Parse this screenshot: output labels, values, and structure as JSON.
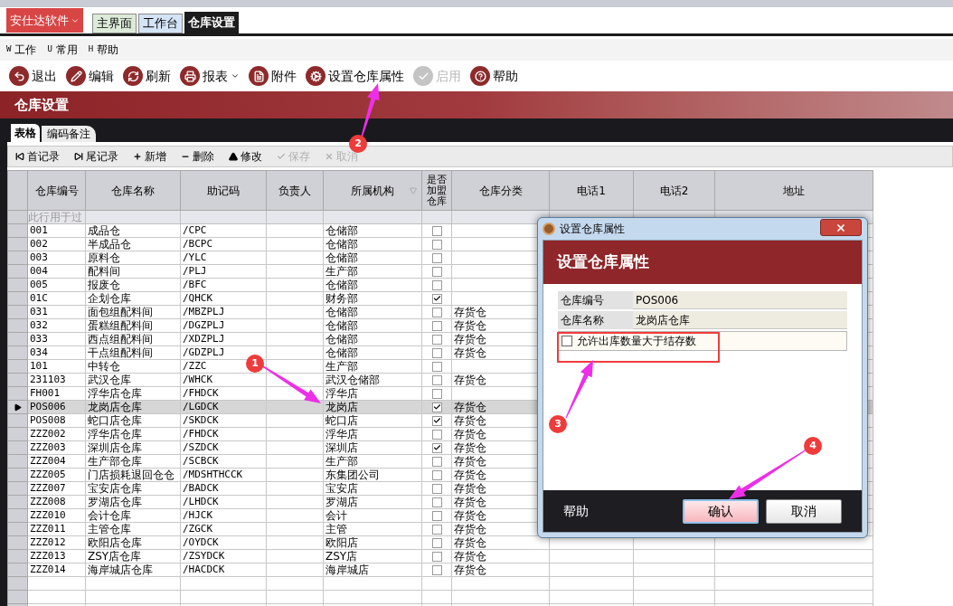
{
  "app_menu": {
    "label": "安仕达软件"
  },
  "tabs": [
    {
      "label": "主界面",
      "selected": false
    },
    {
      "label": "工作台",
      "selected": false
    },
    {
      "label": "仓库设置",
      "selected": true
    }
  ],
  "menu": [
    {
      "key": "W",
      "label": "工作"
    },
    {
      "key": "U",
      "label": "常用"
    },
    {
      "key": "H",
      "label": "帮助"
    }
  ],
  "toolbar": [
    {
      "kind": "exit",
      "label": "退出",
      "disabled": false
    },
    {
      "kind": "edit",
      "label": "编辑",
      "disabled": false
    },
    {
      "kind": "refresh",
      "label": "刷新",
      "disabled": false
    },
    {
      "kind": "print",
      "label": "报表",
      "disabled": false,
      "dropdown": true
    },
    {
      "kind": "attach",
      "label": "附件",
      "disabled": false
    },
    {
      "kind": "gear",
      "label": "设置仓库属性",
      "disabled": false
    },
    {
      "kind": "check",
      "label": "启用",
      "disabled": true
    },
    {
      "kind": "help",
      "label": "帮助",
      "disabled": false
    }
  ],
  "section_title": "仓库设置",
  "sub_tabs": [
    {
      "label": "表格",
      "selected": true
    },
    {
      "label": "编码备注",
      "selected": false
    }
  ],
  "grid_toolbar": [
    {
      "kind": "first",
      "label": "首记录",
      "disabled": false
    },
    {
      "kind": "last",
      "label": "尾记录",
      "disabled": false
    },
    {
      "kind": "add",
      "label": "新增",
      "disabled": false
    },
    {
      "kind": "delete",
      "label": "删除",
      "disabled": false
    },
    {
      "kind": "up",
      "label": "修改",
      "disabled": false
    },
    {
      "kind": "save",
      "label": "保存",
      "disabled": true
    },
    {
      "kind": "cancel",
      "label": "取消",
      "disabled": true
    }
  ],
  "table": {
    "columns": [
      "仓库编号",
      "仓库名称",
      "助记码",
      "负责人",
      "所属机构",
      "是否加盟仓库",
      "仓库分类",
      "电话1",
      "电话2",
      "地址"
    ],
    "filter_hint": "此行用于过",
    "rows": [
      {
        "code": "001",
        "name": "成品仓",
        "mnemonic": "/CPC",
        "org": "仓储部",
        "franchise": false,
        "category": "",
        "selected": false
      },
      {
        "code": "002",
        "name": "半成品仓",
        "mnemonic": "/BCPC",
        "org": "仓储部",
        "franchise": false,
        "category": "",
        "selected": false
      },
      {
        "code": "003",
        "name": "原料仓",
        "mnemonic": "/YLC",
        "org": "仓储部",
        "franchise": false,
        "category": "",
        "selected": false
      },
      {
        "code": "004",
        "name": "配料间",
        "mnemonic": "/PLJ",
        "org": "生产部",
        "franchise": false,
        "category": "",
        "selected": false
      },
      {
        "code": "005",
        "name": "报废仓",
        "mnemonic": "/BFC",
        "org": "仓储部",
        "franchise": false,
        "category": "",
        "selected": false
      },
      {
        "code": "01C",
        "name": "企划仓库",
        "mnemonic": "/QHCK",
        "org": "财务部",
        "franchise": true,
        "category": "",
        "selected": false
      },
      {
        "code": "031",
        "name": "面包组配料间",
        "mnemonic": "/MBZPLJ",
        "org": "仓储部",
        "franchise": false,
        "category": "存货仓",
        "selected": false
      },
      {
        "code": "032",
        "name": "蛋糕组配料间",
        "mnemonic": "/DGZPLJ",
        "org": "仓储部",
        "franchise": false,
        "category": "存货仓",
        "selected": false
      },
      {
        "code": "033",
        "name": "西点组配料间",
        "mnemonic": "/XDZPLJ",
        "org": "仓储部",
        "franchise": false,
        "category": "存货仓",
        "selected": false
      },
      {
        "code": "034",
        "name": "干点组配料间",
        "mnemonic": "/GDZPLJ",
        "org": "仓储部",
        "franchise": false,
        "category": "存货仓",
        "selected": false
      },
      {
        "code": "101",
        "name": "中转仓",
        "mnemonic": "/ZZC",
        "org": "生产部",
        "franchise": false,
        "category": "",
        "selected": false
      },
      {
        "code": "231103",
        "name": "武汉仓库",
        "mnemonic": "/WHCK",
        "org": "武汉仓储部",
        "franchise": false,
        "category": "存货仓",
        "selected": false
      },
      {
        "code": "FH001",
        "name": "浮华店仓库",
        "mnemonic": "/FHDCK",
        "org": "浮华店",
        "franchise": false,
        "category": "",
        "selected": false
      },
      {
        "code": "POS006",
        "name": "龙岗店仓库",
        "mnemonic": "/LGDCK",
        "org": "龙岗店",
        "franchise": true,
        "category": "存货仓",
        "selected": true
      },
      {
        "code": "POS008",
        "name": "蛇口店仓库",
        "mnemonic": "/SKDCK",
        "org": "蛇口店",
        "franchise": true,
        "category": "存货仓",
        "selected": false
      },
      {
        "code": "ZZZ002",
        "name": "浮华店仓库",
        "mnemonic": "/FHDCK",
        "org": "浮华店",
        "franchise": false,
        "category": "存货仓",
        "selected": false
      },
      {
        "code": "ZZZ003",
        "name": "深圳店仓库",
        "mnemonic": "/SZDCK",
        "org": "深圳店",
        "franchise": true,
        "category": "存货仓",
        "selected": false
      },
      {
        "code": "ZZZ004",
        "name": "生产部仓库",
        "mnemonic": "/SCBCK",
        "org": "生产部",
        "franchise": false,
        "category": "存货仓",
        "selected": false
      },
      {
        "code": "ZZZ005",
        "name": "门店损耗退回仓仓",
        "mnemonic": "/MDSHTHCCK",
        "org": "东集团公司",
        "franchise": false,
        "category": "存货仓",
        "selected": false
      },
      {
        "code": "ZZZ007",
        "name": "宝安店仓库",
        "mnemonic": "/BADCK",
        "org": "宝安店",
        "franchise": false,
        "category": "存货仓",
        "selected": false
      },
      {
        "code": "ZZZ008",
        "name": "罗湖店仓库",
        "mnemonic": "/LHDCK",
        "org": "罗湖店",
        "franchise": false,
        "category": "存货仓",
        "selected": false
      },
      {
        "code": "ZZZ010",
        "name": "会计仓库",
        "mnemonic": "/HJCK",
        "org": "会计",
        "franchise": false,
        "category": "存货仓",
        "selected": false
      },
      {
        "code": "ZZZ011",
        "name": "主管仓库",
        "mnemonic": "/ZGCK",
        "org": "主管",
        "franchise": false,
        "category": "存货仓",
        "selected": false
      },
      {
        "code": "ZZZ012",
        "name": "欧阳店仓库",
        "mnemonic": "/OYDCK",
        "org": "欧阳店",
        "franchise": false,
        "category": "存货仓",
        "selected": false
      },
      {
        "code": "ZZZ013",
        "name": "ZSY店仓库",
        "mnemonic": "/ZSYDCK",
        "org": "ZSY店",
        "franchise": false,
        "category": "存货仓",
        "selected": false
      },
      {
        "code": "ZZZ014",
        "name": "海岸城店仓库",
        "mnemonic": "/HACDCK",
        "org": "海岸城店",
        "franchise": false,
        "category": "存货仓",
        "selected": false
      }
    ]
  },
  "dialog": {
    "title": "设置仓库属性",
    "heading": "设置仓库属性",
    "fields": [
      {
        "label": "仓库编号",
        "value": "POS006"
      },
      {
        "label": "仓库名称",
        "value": "龙岗店仓库"
      }
    ],
    "option": {
      "label": "允许出库数量大于结存数",
      "checked": false
    },
    "help": "帮助",
    "buttons": [
      {
        "label": "确认",
        "focused": true
      },
      {
        "label": "取消",
        "focused": false
      }
    ]
  },
  "annotations": [
    {
      "label": "1"
    },
    {
      "label": "2"
    },
    {
      "label": "3"
    },
    {
      "label": "4"
    }
  ]
}
